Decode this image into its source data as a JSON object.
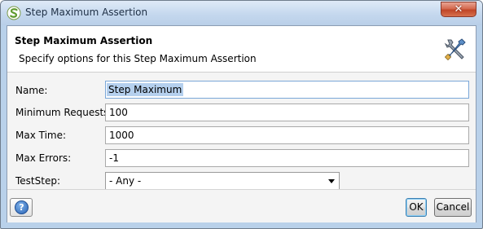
{
  "window": {
    "title": "Step Maximum Assertion",
    "close_label": "✕"
  },
  "header": {
    "title": "Step Maximum Assertion",
    "description": "Specify options for this Step Maximum Assertion",
    "icon": "tools-icon"
  },
  "form": {
    "name": {
      "label": "Name:",
      "value": "Step Maximum"
    },
    "min_requests": {
      "label": "Minimum Requests:",
      "value": "100"
    },
    "max_time": {
      "label": "Max Time:",
      "value": "1000"
    },
    "max_errors": {
      "label": "Max Errors:",
      "value": "-1"
    },
    "teststep": {
      "label": "TestStep:",
      "selected": "- Any -"
    }
  },
  "footer": {
    "help_label": "?",
    "ok_label": "OK",
    "cancel_label": "Cancel"
  },
  "colors": {
    "frame": "#b9d1ea",
    "close_button": "#c04527",
    "help_icon": "#2a64b6",
    "selection": "#b5d0ee"
  }
}
